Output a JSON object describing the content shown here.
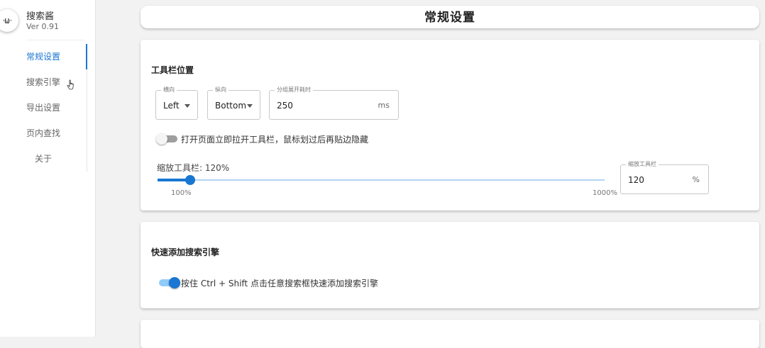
{
  "sidebar": {
    "logo_text": "ᐧωᐧ",
    "app_name": "搜索酱",
    "version": "Ver 0.91",
    "items": [
      {
        "label": "常规设置",
        "active": true
      },
      {
        "label": "搜索引擎",
        "active": false
      },
      {
        "label": "导出设置",
        "active": false
      },
      {
        "label": "页内查找",
        "active": false
      },
      {
        "label": "关于",
        "active": false
      }
    ],
    "cursor_icon": "hand-pointer-icon"
  },
  "header": {
    "title": "常规设置"
  },
  "toolbar_section": {
    "title": "工具栏位置",
    "horizontal": {
      "legend": "横向",
      "value": "Left"
    },
    "vertical": {
      "legend": "纵向",
      "value": "Bottom"
    },
    "group_delay": {
      "legend": "分组展开耗时",
      "value": "250",
      "unit": "ms"
    },
    "auto_open_toggle": {
      "label": "打开页面立即拉开工具栏，鼠标划过后再贴边隐藏",
      "on": false
    },
    "scale": {
      "label": "缩放工具栏: 120%",
      "value": 120,
      "min": 100,
      "max": 1000,
      "min_label": "100%",
      "max_label": "1000%",
      "input_legend": "缩放工具栏",
      "input_value": "120",
      "input_unit": "%"
    }
  },
  "quick_add_section": {
    "title": "快速添加搜索引擎",
    "toggle": {
      "label": "按住 Ctrl + Shift 点击任意搜索框快速添加搜索引擎",
      "on": true
    }
  },
  "colors": {
    "accent": "#1976d2",
    "accent_light": "#90caf9"
  }
}
